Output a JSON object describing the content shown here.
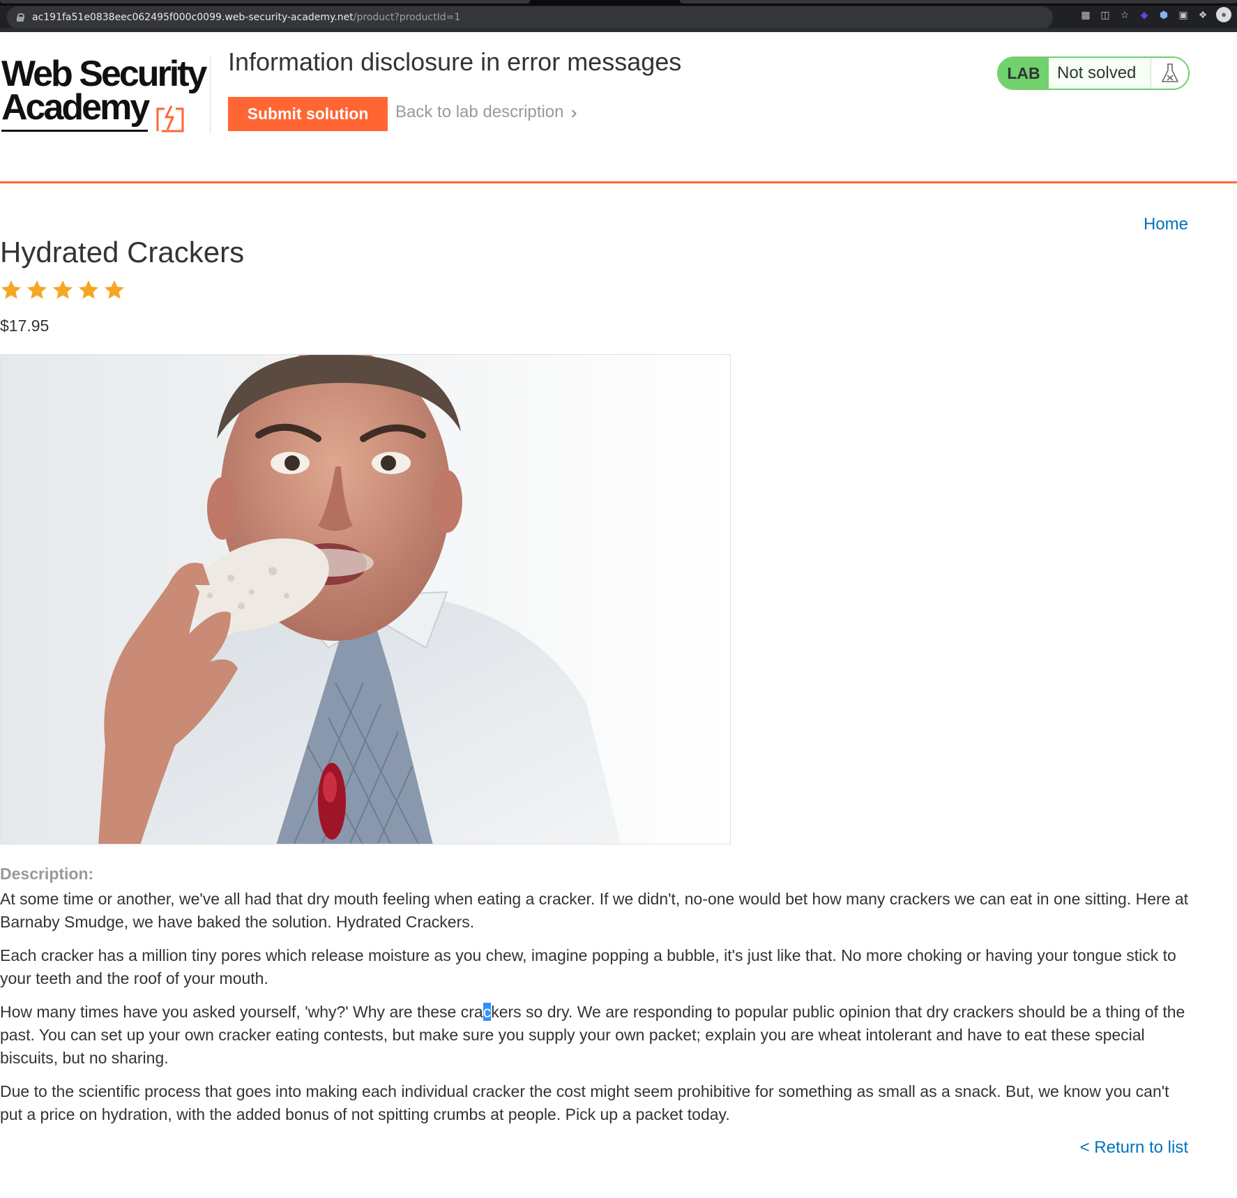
{
  "browser": {
    "url_host": "ac191fa51e0838eec062495f000c0099.web-security-academy.net",
    "url_path": "/product?productId=1"
  },
  "header": {
    "logo_line1": "Web Security",
    "logo_line2": "Academy",
    "lab_title": "Information disclosure in error messages",
    "submit_label": "Submit solution",
    "back_label": "Back to lab description",
    "lab_tag": "LAB",
    "lab_status": "Not solved"
  },
  "nav": {
    "home_label": "Home"
  },
  "product": {
    "title": "Hydrated Crackers",
    "rating_stars": 5,
    "price": "$17.95",
    "description_label": "Description:",
    "paragraphs": {
      "p1": "At some time or another, we've all had that dry mouth feeling when eating a cracker. If we didn't, no-one would bet how many crackers we can eat in one sitting. Here at Barnaby Smudge, we have baked the solution. Hydrated Crackers.",
      "p2": "Each cracker has a million tiny pores which release moisture as you chew, imagine popping a bubble, it's just like that. No more choking or having your tongue stick to your teeth and the roof of your mouth.",
      "p3_before": "How many times have you asked yourself, 'why?' Why are these cra",
      "p3_selected": "c",
      "p3_after": "kers so dry. We are responding to popular public opinion that dry crackers should be a thing of the past. You can set up your own cracker eating contests, but make sure you supply your own packet; explain you are wheat intolerant and have to eat these special biscuits, but no sharing.",
      "p4": "Due to the scientific process that goes into making each individual cracker the cost might seem prohibitive for something as small as a snack. But, we know you can't put a price on hydration, with the added bonus of not spitting crumbs at people. Pick up a packet today."
    },
    "return_label": "< Return to list"
  },
  "colors": {
    "accent": "#ff6633",
    "lab_green": "#70d16d",
    "link_blue": "#0071bc",
    "star_gold": "#f5a623"
  },
  "icons": {
    "lock": "lock-icon",
    "chevrons": "double-chevron-right-icon",
    "flask": "flask-icon",
    "star": "star-icon"
  }
}
